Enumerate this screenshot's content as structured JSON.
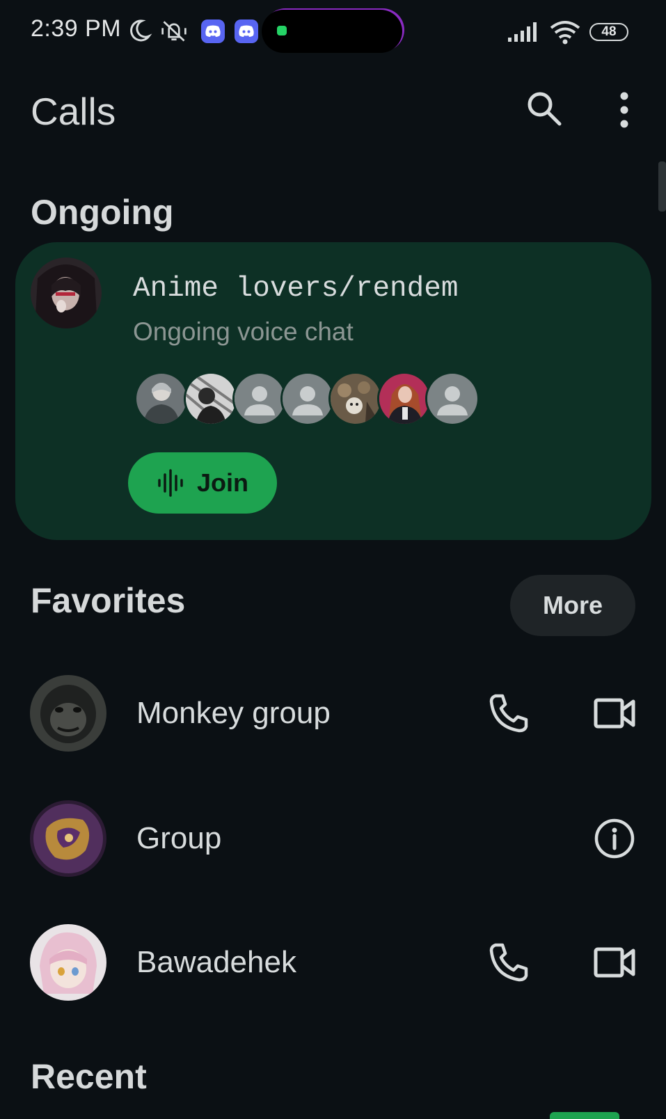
{
  "status_bar": {
    "time": "2:39 PM",
    "battery": "48",
    "icons": [
      "moon-icon",
      "vibrate-off-icon",
      "discord-icon",
      "discord-icon",
      "whatsapp-icon",
      "signal-icon",
      "wifi-icon",
      "battery-icon"
    ]
  },
  "header": {
    "title": "Calls",
    "actions": [
      "search-icon",
      "more-vert-icon"
    ]
  },
  "ongoing": {
    "section_title": "Ongoing",
    "chat_name": "Anime lovers/rendem",
    "chat_status": "Ongoing voice chat",
    "participant_count": 7,
    "join_label": "Join"
  },
  "favorites": {
    "section_title": "Favorites",
    "more_label": "More",
    "items": [
      {
        "name": "Monkey group",
        "actions": [
          "phone-icon",
          "video-icon"
        ]
      },
      {
        "name": "Group",
        "actions": [
          "info-icon"
        ]
      },
      {
        "name": "Bawadehek",
        "actions": [
          "phone-icon",
          "video-icon"
        ]
      }
    ]
  },
  "recent": {
    "section_title": "Recent"
  },
  "colors": {
    "background": "#0b1014",
    "card": "#0d3025",
    "accent": "#1ea350",
    "chip": "#1f2427"
  }
}
